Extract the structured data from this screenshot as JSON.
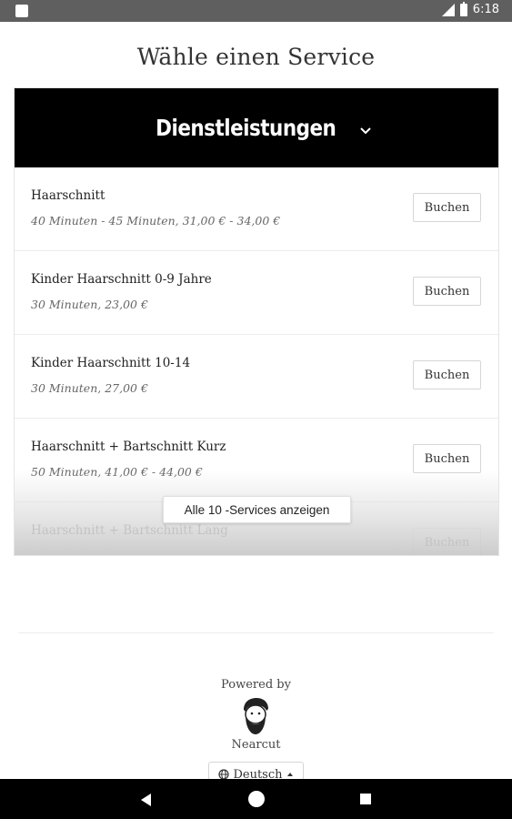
{
  "status_bar": {
    "time": "6:18"
  },
  "page": {
    "title": "Wähle einen Service"
  },
  "services_panel": {
    "header": "Dienstleistungen",
    "items": [
      {
        "name": "Haarschnitt",
        "meta": "40 Minuten - 45 Minuten, 31,00 € - 34,00 €",
        "button": "Buchen"
      },
      {
        "name": "Kinder Haarschnitt 0-9 Jahre",
        "meta": "30 Minuten, 23,00 €",
        "button": "Buchen"
      },
      {
        "name": "Kinder Haarschnitt 10-14",
        "meta": "30 Minuten, 27,00 €",
        "button": "Buchen"
      },
      {
        "name": "Haarschnitt + Bartschnitt Kurz",
        "meta": "50 Minuten, 41,00 € - 44,00 €",
        "button": "Buchen"
      },
      {
        "name": "Haarschnitt + Bartschnitt Lang",
        "meta": "",
        "button": "Buchen"
      }
    ],
    "show_all": "Alle 10 -Services anzeigen"
  },
  "footer": {
    "powered_by": "Powered by",
    "brand": "Nearcut",
    "language": "Deutsch"
  }
}
